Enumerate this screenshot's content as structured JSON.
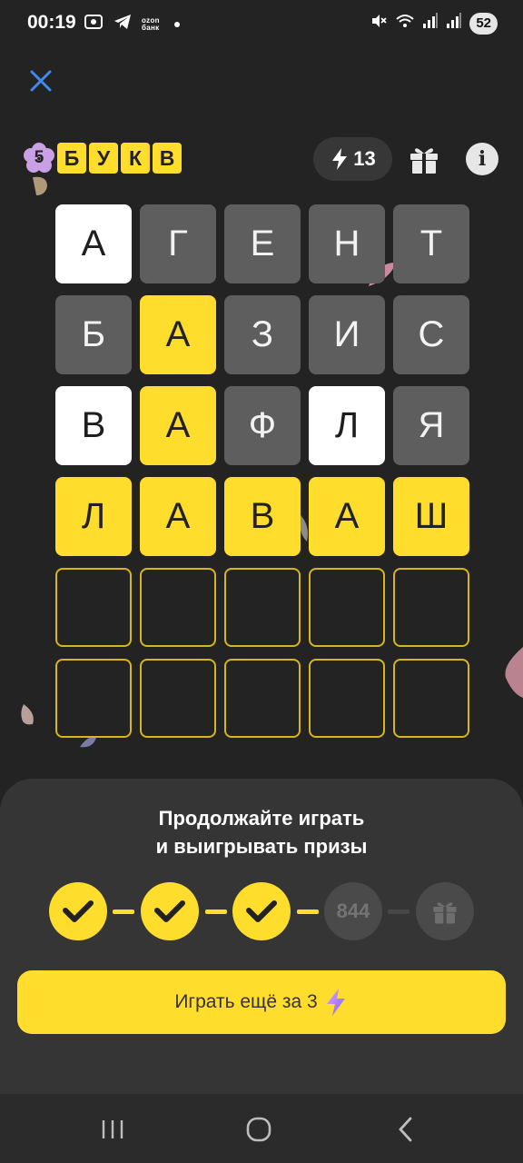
{
  "status_bar": {
    "time": "00:19",
    "ozon_label_line1": "ozon",
    "ozon_label_line2": "банк",
    "battery": "52",
    "icons": [
      "screenshot-icon",
      "telegram-icon",
      "ozon-bank-icon",
      "notification-dot-icon",
      "mute-icon",
      "wifi-icon",
      "signal-icon",
      "signal-icon",
      "battery-icon"
    ]
  },
  "header": {
    "logo_number": "5",
    "logo_letters": [
      "Б",
      "У",
      "К",
      "В"
    ],
    "energy_value": "13",
    "icons": [
      "close-icon",
      "lightning-icon",
      "gift-icon",
      "info-icon"
    ]
  },
  "board": {
    "rows": [
      [
        {
          "letter": "А",
          "state": "white"
        },
        {
          "letter": "Г",
          "state": "gray"
        },
        {
          "letter": "Е",
          "state": "gray"
        },
        {
          "letter": "Н",
          "state": "gray"
        },
        {
          "letter": "Т",
          "state": "gray"
        }
      ],
      [
        {
          "letter": "Б",
          "state": "gray"
        },
        {
          "letter": "А",
          "state": "yellow"
        },
        {
          "letter": "З",
          "state": "gray"
        },
        {
          "letter": "И",
          "state": "gray"
        },
        {
          "letter": "С",
          "state": "gray"
        }
      ],
      [
        {
          "letter": "В",
          "state": "white"
        },
        {
          "letter": "А",
          "state": "yellow"
        },
        {
          "letter": "Ф",
          "state": "gray"
        },
        {
          "letter": "Л",
          "state": "white"
        },
        {
          "letter": "Я",
          "state": "gray"
        }
      ],
      [
        {
          "letter": "Л",
          "state": "yellow"
        },
        {
          "letter": "А",
          "state": "yellow"
        },
        {
          "letter": "В",
          "state": "yellow"
        },
        {
          "letter": "А",
          "state": "yellow"
        },
        {
          "letter": "Ш",
          "state": "yellow"
        }
      ],
      [
        {
          "letter": "",
          "state": "empty"
        },
        {
          "letter": "",
          "state": "empty"
        },
        {
          "letter": "",
          "state": "empty"
        },
        {
          "letter": "",
          "state": "empty"
        },
        {
          "letter": "",
          "state": "empty"
        }
      ],
      [
        {
          "letter": "",
          "state": "empty"
        },
        {
          "letter": "",
          "state": "empty"
        },
        {
          "letter": "",
          "state": "empty"
        },
        {
          "letter": "",
          "state": "empty"
        },
        {
          "letter": "",
          "state": "empty"
        }
      ]
    ]
  },
  "sheet": {
    "title_line1": "Продолжайте играть",
    "title_line2": "и выигрывать призы",
    "steps": [
      {
        "state": "done",
        "icon": "check-icon"
      },
      {
        "state": "done",
        "icon": "check-icon"
      },
      {
        "state": "done",
        "icon": "check-icon"
      },
      {
        "state": "pending",
        "label": "844"
      },
      {
        "state": "pending",
        "icon": "gift-icon"
      }
    ],
    "play_button_label": "Играть ещё за 3"
  },
  "colors": {
    "accent_yellow": "#ffdd2d",
    "background": "#232323",
    "sheet": "#353535",
    "tile_gray": "#5e5e5e",
    "tile_white": "#ffffff",
    "close_blue": "#3d8bf2"
  },
  "navbar": {
    "icons": [
      "recents-icon",
      "home-icon",
      "back-icon"
    ]
  }
}
